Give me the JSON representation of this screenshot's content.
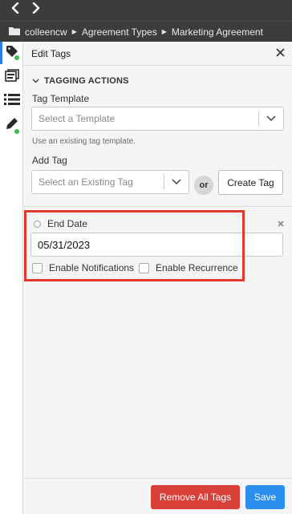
{
  "nav": {
    "back_icon": "chevron-left-icon",
    "forward_icon": "chevron-right-icon"
  },
  "breadcrumb": {
    "folder_icon": "folder-icon",
    "items": [
      "colleencw",
      "Agreement Types",
      "Marketing Agreement"
    ]
  },
  "rail": {
    "items": [
      {
        "icon": "tag-icon",
        "active": true,
        "badge": true
      },
      {
        "icon": "documents-icon",
        "active": false,
        "badge": false
      },
      {
        "icon": "list-icon",
        "active": false,
        "badge": false
      },
      {
        "icon": "pen-icon",
        "active": false,
        "badge": true
      }
    ],
    "badge_color": "#3fb950"
  },
  "panel": {
    "title": "Edit Tags",
    "section_title": "TAGGING ACTIONS",
    "tag_template_label": "Tag Template",
    "tag_template_placeholder": "Select a Template",
    "tag_template_hint": "Use an existing tag template.",
    "add_tag_label": "Add Tag",
    "add_tag_placeholder": "Select an Existing Tag",
    "or_label": "or",
    "create_tag_label": "Create Tag"
  },
  "tag": {
    "name": "End Date",
    "value": "05/31/2023",
    "enable_notifications_label": "Enable Notifications",
    "enable_notifications_checked": false,
    "enable_recurrence_label": "Enable Recurrence",
    "enable_recurrence_checked": false
  },
  "footer": {
    "remove_all_label": "Remove All Tags",
    "save_label": "Save"
  },
  "colors": {
    "danger": "#d9403a",
    "primary": "#2b8ff0",
    "highlight": "#e03a2a",
    "accent": "#2b7de9"
  }
}
